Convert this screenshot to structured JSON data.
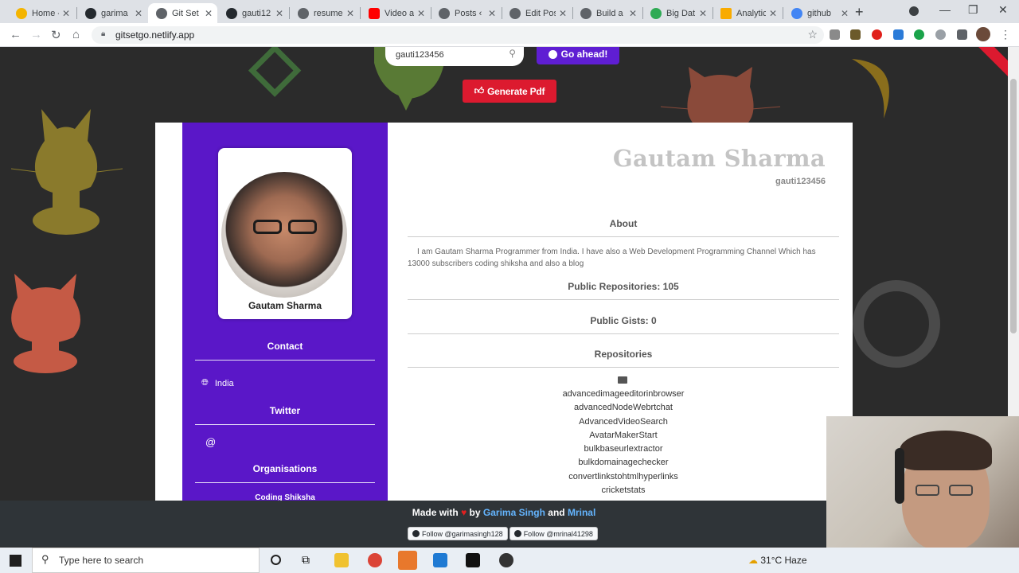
{
  "browser": {
    "tabs": [
      {
        "title": "Home -",
        "active": false
      },
      {
        "title": "garima",
        "active": false
      },
      {
        "title": "Git Set",
        "active": true
      },
      {
        "title": "gauti12",
        "active": false
      },
      {
        "title": "resume",
        "active": false
      },
      {
        "title": "Video a",
        "active": false
      },
      {
        "title": "Posts ‹",
        "active": false
      },
      {
        "title": "Edit Pos",
        "active": false
      },
      {
        "title": "Build a",
        "active": false
      },
      {
        "title": "Big Dat",
        "active": false
      },
      {
        "title": "Analytic",
        "active": false
      },
      {
        "title": "github",
        "active": false
      }
    ],
    "url": "gitsetgo.netlify.app"
  },
  "page": {
    "search_value": "gauti123456",
    "go_label": "Go ahead!",
    "generate_label": "Generate Pdf"
  },
  "profile": {
    "photo_name": "Gautam Sharma",
    "name": "Gautam Sharma",
    "username": "gauti123456",
    "contact_heading": "Contact",
    "location": "India",
    "twitter_heading": "Twitter",
    "twitter_handle": "@",
    "org_heading": "Organisations",
    "organisation": "Coding Shiksha",
    "about_heading": "About",
    "about_text": "I am Gautam Sharma Programmer from India. I have also a Web Development Programming Channel Which has 13000 subscribers coding shiksha and also a blog",
    "public_repos": "Public Repositories: 105",
    "public_gists": "Public Gists: 0",
    "repos_heading": "Repositories",
    "repos": [
      "advancedimageeditorinbrowser",
      "advancedNodeWebrtchat",
      "AdvancedVideoSearch",
      "AvatarMakerStart",
      "bulkbaseurlextractor",
      "bulkdomainagechecker",
      "convertlinkstohtmlhyperlinks",
      "cricketstats"
    ]
  },
  "footer": {
    "made_with": "Made with",
    "by": "by",
    "author1": "Garima Singh",
    "and": "and",
    "author2": "Mrinal",
    "follow1": "Follow @garimasingh128",
    "follow2": "Follow @mrinal41298"
  },
  "taskbar": {
    "search_placeholder": "Type here to search",
    "weather": "31°C  Haze"
  },
  "colors": {
    "sidebar": "#5a17c8",
    "accent_red": "#dc1a2f",
    "go_button": "#5f1ed3"
  }
}
